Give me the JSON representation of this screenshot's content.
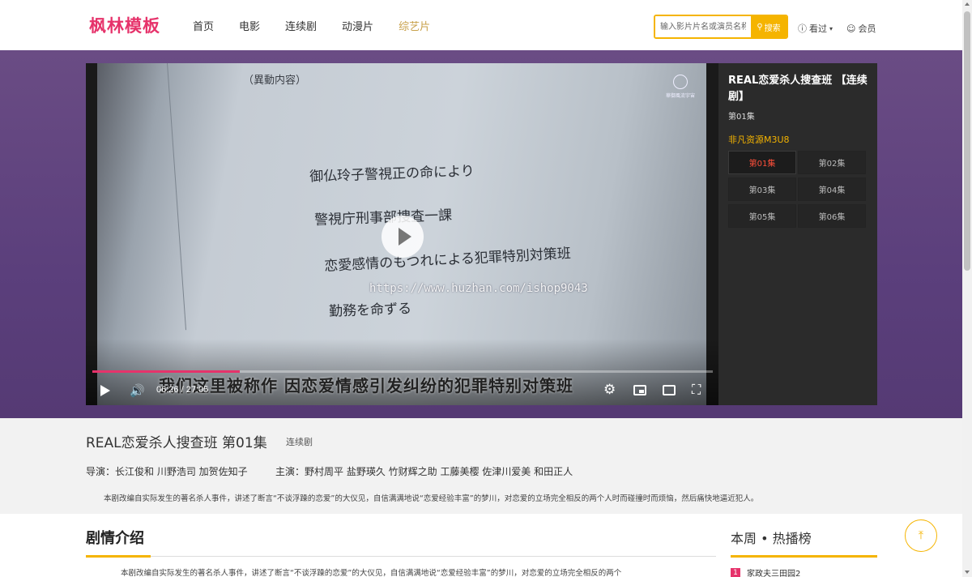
{
  "header": {
    "logo": "枫林模板",
    "nav": [
      "首页",
      "电影",
      "连续剧",
      "动漫片",
      "综艺片"
    ],
    "active_nav_index": 4,
    "search_placeholder": "输入影片片名或演员名称",
    "search_button": "搜索",
    "history_label": "看过",
    "member_label": "会员"
  },
  "video": {
    "doc_lines": [
      "（異動内容）",
      "御仏玲子警視正の命により",
      "警視庁刑事部捜査一課",
      "恋愛感情のもつれによる犯罪特別対策班",
      "勤務を命ずる"
    ],
    "watermark_text": "華御風流宇宙",
    "url_overlay": "https://www.huzhan.com/ishop9043",
    "subtitle": "我们这里被称作 因恋爱情感引发纠纷的犯罪特别对策班",
    "time_display": "06:26 / 27:05",
    "progress_fraction": 0.237
  },
  "panel": {
    "title": "REAL恋爱杀人搜查班 【连续剧】",
    "current_episode": "第01集",
    "source": "非凡资源M3U8",
    "episodes": [
      "第01集",
      "第02集",
      "第03集",
      "第04集",
      "第05集",
      "第06集"
    ],
    "active_episode_index": 0
  },
  "info": {
    "title": "REAL恋爱杀人搜查班 第01集",
    "tag": "连续剧",
    "director": "导演：长江俊和 川野浩司 加贺佐知子",
    "cast": "主演：野村周平 盐野瑛久 竹财辉之助 工藤美樱 佐津川爱美 和田正人",
    "description": "本剧改编自实际发生的著名杀人事件，讲述了断言“不谈浮躁的恋爱”的大仪见，自信满满地说“恋爱经验丰富”的梦川，对恋爱的立场完全相反的两个人时而碰撞时而烦恼，然后痛快地逼近犯人。"
  },
  "plot": {
    "heading": "剧情介绍",
    "text": "本剧改编自实际发生的著名杀人事件，讲述了断言“不谈浮躁的恋爱”的大仪见，自信满满地说“恋爱经验丰富”的梦川，对恋爱的立场完全相反的两个"
  },
  "ranking": {
    "heading": "本周 • 热播榜",
    "items": [
      {
        "rank": "1",
        "title": "家政夫三田园2"
      }
    ]
  },
  "colors": {
    "brand": "#e6336b",
    "accent": "#f5b400",
    "band": "#5b3f7c",
    "active_episode": "#ff4f3a"
  },
  "icons": {
    "search": "search-icon",
    "history": "history-icon",
    "member": "user-icon",
    "to_top": "arrow-up-icon"
  }
}
